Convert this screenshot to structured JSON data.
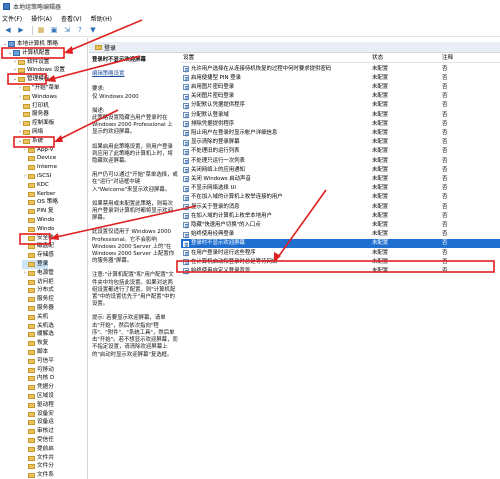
{
  "window": {
    "title": "本地组策略编辑器"
  },
  "menu": [
    "文件(F)",
    "操作(A)",
    "查看(V)",
    "帮助(H)"
  ],
  "toolbar": [
    "back-icon",
    "forward-icon",
    "up-folder-icon",
    "show-hide-icon",
    "export-icon",
    "help-icon",
    "filter-icon"
  ],
  "tree": [
    {
      "label": "本地计算机 策略",
      "depth": 0,
      "expander": "v",
      "icon": "computer"
    },
    {
      "label": "计算机配置",
      "depth": 1,
      "expander": "v",
      "icon": "computer"
    },
    {
      "label": "软件设置",
      "depth": 2,
      "expander": ">",
      "icon": "folder"
    },
    {
      "label": "Windows 设置",
      "depth": 2,
      "expander": ">",
      "icon": "folder"
    },
    {
      "label": "管理模板",
      "depth": 2,
      "expander": "v",
      "icon": "folder"
    },
    {
      "label": "\"开始\"菜单",
      "depth": 3,
      "expander": ">",
      "icon": "folder"
    },
    {
      "label": "Windows",
      "depth": 3,
      "expander": ">",
      "icon": "folder"
    },
    {
      "label": "打印机",
      "depth": 3,
      "expander": "",
      "icon": "folder"
    },
    {
      "label": "服务器",
      "depth": 3,
      "expander": "",
      "icon": "folder"
    },
    {
      "label": "控制面板",
      "depth": 3,
      "expander": ">",
      "icon": "folder"
    },
    {
      "label": "网络",
      "depth": 3,
      "expander": ">",
      "icon": "folder"
    },
    {
      "label": "系统",
      "depth": 3,
      "expander": "v",
      "icon": "folder"
    },
    {
      "label": "App-V",
      "depth": 4,
      "expander": ">",
      "icon": "folder"
    },
    {
      "label": "Device",
      "depth": 4,
      "expander": "",
      "icon": "folder"
    },
    {
      "label": "Interne",
      "depth": 4,
      "expander": "",
      "icon": "folder"
    },
    {
      "label": "iSCSI",
      "depth": 4,
      "expander": ">",
      "icon": "folder"
    },
    {
      "label": "KDC",
      "depth": 4,
      "expander": "",
      "icon": "folder"
    },
    {
      "label": "Kerber",
      "depth": 4,
      "expander": "",
      "icon": "folder"
    },
    {
      "label": "OS 策略",
      "depth": 4,
      "expander": "",
      "icon": "folder"
    },
    {
      "label": "PIN 复",
      "depth": 4,
      "expander": "",
      "icon": "folder"
    },
    {
      "label": "Windo",
      "depth": 4,
      "expander": "",
      "icon": "folder"
    },
    {
      "label": "Windo",
      "depth": 4,
      "expander": "",
      "icon": "folder"
    },
    {
      "label": "安全帐",
      "depth": 4,
      "expander": "",
      "icon": "folder"
    },
    {
      "label": "磁盘配",
      "depth": 4,
      "expander": "",
      "icon": "folder"
    },
    {
      "label": "存储感",
      "depth": 4,
      "expander": "",
      "icon": "folder"
    },
    {
      "label": "登录",
      "depth": 4,
      "expander": "",
      "icon": "folder",
      "selected": true
    },
    {
      "label": "电源管",
      "depth": 4,
      "expander": ">",
      "icon": "folder"
    },
    {
      "label": "访问拒",
      "depth": 4,
      "expander": "",
      "icon": "folder"
    },
    {
      "label": "分布式",
      "depth": 4,
      "expander": "",
      "icon": "folder"
    },
    {
      "label": "服务控",
      "depth": 4,
      "expander": "",
      "icon": "folder"
    },
    {
      "label": "服务器",
      "depth": 4,
      "expander": "",
      "icon": "folder"
    },
    {
      "label": "关机",
      "depth": 4,
      "expander": "",
      "icon": "folder"
    },
    {
      "label": "关机选",
      "depth": 4,
      "expander": "",
      "icon": "folder"
    },
    {
      "label": "缓解选",
      "depth": 4,
      "expander": "",
      "icon": "folder"
    },
    {
      "label": "恢复",
      "depth": 4,
      "expander": "",
      "icon": "folder"
    },
    {
      "label": "脚本",
      "depth": 4,
      "expander": "",
      "icon": "folder"
    },
    {
      "label": "可信平",
      "depth": 4,
      "expander": "",
      "icon": "folder"
    },
    {
      "label": "可移动",
      "depth": 4,
      "expander": "",
      "icon": "folder"
    },
    {
      "label": "内核 D",
      "depth": 4,
      "expander": "",
      "icon": "folder"
    },
    {
      "label": "凭据分",
      "depth": 4,
      "expander": "",
      "icon": "folder"
    },
    {
      "label": "区域设",
      "depth": 4,
      "expander": "",
      "icon": "folder"
    },
    {
      "label": "驱动程",
      "depth": 4,
      "expander": "",
      "icon": "folder"
    },
    {
      "label": "设备安",
      "depth": 4,
      "expander": "",
      "icon": "folder"
    },
    {
      "label": "设备运",
      "depth": 4,
      "expander": "",
      "icon": "folder"
    },
    {
      "label": "审核过",
      "depth": 4,
      "expander": "",
      "icon": "folder"
    },
    {
      "label": "受信任",
      "depth": 4,
      "expander": "",
      "icon": "folder"
    },
    {
      "label": "提前启",
      "depth": 4,
      "expander": "",
      "icon": "folder"
    },
    {
      "label": "文件共",
      "depth": 4,
      "expander": "",
      "icon": "folder"
    },
    {
      "label": "文件分",
      "depth": 4,
      "expander": "",
      "icon": "folder"
    },
    {
      "label": "文件系",
      "depth": 4,
      "expander": "",
      "icon": "folder"
    }
  ],
  "section": {
    "title": "登录"
  },
  "description": {
    "title": "登录时不显示欢迎屏幕",
    "edit_link": "编辑策略设置",
    "req_label": "要求:",
    "req_value": "仅 Windows 2000",
    "desc_label": "描述:",
    "p1": "此策略设置隐藏当用户登录时在 Windows 2000 Professional 上显示的欢迎屏幕。",
    "p2": "如果启用此策略设置，则用户登录到应用了此策略的计算机上时，将隐藏欢迎屏幕。",
    "p3": "用户仍可以通过\"开始\"菜单选择，或在\"运行\"对话框中键入\"Welcome\"来显示欢迎屏幕。",
    "p4": "如果禁用或未配置此策略，则每次用户登录到计算机时都将显示欢迎屏幕。",
    "p5": "此设置仅适用于 Windows 2000 Professional。它不会影响 Windows 2000 Server 上的\"在 Windows 2000 Server 上配置你的服务器\"屏幕。",
    "p6": "注意:\"计算机配置\"和\"用户配置\"文件夹中均包括此设置。如果对这两组设置都进行了配置，则\"计算机配置\"中的设置优先于\"用户配置\"中的设置。",
    "p7": "提示: 若要显示欢迎屏幕，请单击\"开始\"，然后依次指向\"程序\"、\"附件\"、\"系统工具\"，然后单击\"开始\"。若不想显示欢迎屏幕，而不指定设置，请清除欢迎屏幕上的\"启动时显示欢迎屏幕\"复选框。"
  },
  "list": {
    "headers": {
      "setting": "设置",
      "state": "状态",
      "note": "注释"
    },
    "rows": [
      {
        "setting": "允许用户选择在从连接待机恢复的过程中何时要求提供密码",
        "state": "未配置",
        "note": "否"
      },
      {
        "setting": "启用便捷型 PIN 登录",
        "state": "未配置",
        "note": "否"
      },
      {
        "setting": "启用图片密码登录",
        "state": "未配置",
        "note": "否"
      },
      {
        "setting": "关闭图片密码登录",
        "state": "未配置",
        "note": "否"
      },
      {
        "setting": "分配默认凭据提供程序",
        "state": "未配置",
        "note": "否"
      },
      {
        "setting": "分配默认登录域",
        "state": "未配置",
        "note": "否"
      },
      {
        "setting": "排除凭据提供程序",
        "state": "未配置",
        "note": "否"
      },
      {
        "setting": "阻止用户在登录时显示帐户详细信息",
        "state": "未配置",
        "note": "否"
      },
      {
        "setting": "显示清除的登录屏幕",
        "state": "未配置",
        "note": "否"
      },
      {
        "setting": "不处理旧的运行列表",
        "state": "未配置",
        "note": "否"
      },
      {
        "setting": "不处理只运行一次列表",
        "state": "未配置",
        "note": "否"
      },
      {
        "setting": "关闭网络上的应用通知",
        "state": "未配置",
        "note": "否"
      },
      {
        "setting": "关闭 Windows 启动声音",
        "state": "未配置",
        "note": "否"
      },
      {
        "setting": "不显示网络选择 UI",
        "state": "未配置",
        "note": "否"
      },
      {
        "setting": "不在加入域的计算机上枚举连接的用户",
        "state": "未配置",
        "note": "否"
      },
      {
        "setting": "显示关于登录的消息",
        "state": "未配置",
        "note": "否"
      },
      {
        "setting": "在加入域的计算机上枚举本地用户",
        "state": "未配置",
        "note": "否"
      },
      {
        "setting": "隐藏\"快速用户切换\"的入口点",
        "state": "未配置",
        "note": "否"
      },
      {
        "setting": "始终使用经典登录",
        "state": "未配置",
        "note": "否"
      },
      {
        "setting": "登录时不显示欢迎屏幕",
        "state": "未配置",
        "note": "否",
        "selected": true
      },
      {
        "setting": "在用户登录时运行这些程序",
        "state": "未配置",
        "note": "否"
      },
      {
        "setting": "在计算机启动和登录时总是等待网络",
        "state": "未配置",
        "note": "否"
      },
      {
        "setting": "始终使用自定义登录背景",
        "state": "未配置",
        "note": "否"
      }
    ]
  },
  "colors": {
    "highlight": "#1f6fd1",
    "annotation": "#e02020",
    "folder": "#e8c25a"
  }
}
